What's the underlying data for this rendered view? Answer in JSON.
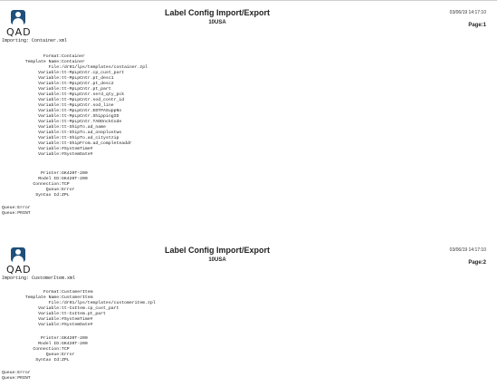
{
  "pages": [
    {
      "logo_text": "QAD",
      "title": "Label Config Import/Export",
      "subtitle": "10USA",
      "timestamp": "03/06/19 14:17:10",
      "page_label": "Page:1",
      "importing": "Importing: Container.xml",
      "main_fields": [
        {
          "k": "Format:",
          "v": "Container"
        },
        {
          "k": "Template Name:",
          "v": "Container"
        },
        {
          "k": "File:",
          "v": "/dr01/lps/templates/container.zpl"
        },
        {
          "k": "Variable:",
          "v": "tt-MpLpCntr.cp_cust_part"
        },
        {
          "k": "Variable:",
          "v": "tt-MpLpCntr.pt_desc1"
        },
        {
          "k": "Variable:",
          "v": "tt-MpLpCntr.pt_desc2"
        },
        {
          "k": "Variable:",
          "v": "tt-MpLpCntr.pt_part"
        },
        {
          "k": "Variable:",
          "v": "tt-MpLpCntr.serd_qty_pck"
        },
        {
          "k": "Variable:",
          "v": "tt-MpLpCntr.sod_contr_id"
        },
        {
          "k": "Variable:",
          "v": "tt-MpLpCntr.sod_line"
        },
        {
          "k": "Variable:",
          "v": "tt-MpLpCntr.EDTPASuppNo"
        },
        {
          "k": "Variable:",
          "v": "tt-MpLpCntr.ShippingID"
        },
        {
          "k": "Variable:",
          "v": "tt-MpLpCntr.TADDnckCode"
        },
        {
          "k": "Variable:",
          "v": "tt-ShipTo.ad_name"
        },
        {
          "k": "Variable:",
          "v": "tt-ShipTo.ad_oneplustwo"
        },
        {
          "k": "Variable:",
          "v": "tt-ShipTo.ad_citystzip"
        },
        {
          "k": "Variable:",
          "v": "tt-ShipFrom.ad_completeaddr"
        },
        {
          "k": "Variable:",
          "v": "#SystemTime#"
        },
        {
          "k": "Variable:",
          "v": "#SystemDate#"
        }
      ],
      "printer_fields": [
        {
          "k": "Printer:",
          "v": "GK420T-200"
        },
        {
          "k": "Model ID:",
          "v": "GK420T-200"
        },
        {
          "k": "Connection:",
          "v": "TCP"
        },
        {
          "k": "Queue:",
          "v": "Error"
        },
        {
          "k": "Syntax Id:",
          "v": "ZPL"
        }
      ],
      "queue_lines": [
        "Queue:Error",
        "Queue:PRINT"
      ]
    },
    {
      "logo_text": "QAD",
      "title": "Label Config Import/Export",
      "subtitle": "10USA",
      "timestamp": "03/06/19 14:17:10",
      "page_label": "Page:2",
      "importing": "Importing: CustomerItem.xml",
      "main_fields": [
        {
          "k": "Format:",
          "v": "CustomerItem"
        },
        {
          "k": "Template Name:",
          "v": "CustomerItem"
        },
        {
          "k": "File:",
          "v": "/dr01/lps/templates/customeritem.zpl"
        },
        {
          "k": "Variable:",
          "v": "tt-CoItem.cp_cust_part"
        },
        {
          "k": "Variable:",
          "v": "tt-CoItem.pt_part"
        },
        {
          "k": "Variable:",
          "v": "#SystemTime#"
        },
        {
          "k": "Variable:",
          "v": "#SystemDate#"
        }
      ],
      "printer_fields": [
        {
          "k": "Printer:",
          "v": "GK420T-200"
        },
        {
          "k": "Model ID:",
          "v": "GK420T-200"
        },
        {
          "k": "Connection:",
          "v": "TCP"
        },
        {
          "k": "Queue:",
          "v": "Error"
        },
        {
          "k": "Syntax Id:",
          "v": "ZPL"
        }
      ],
      "queue_lines": [
        "Queue:Error",
        "Queue:PRINT"
      ]
    }
  ]
}
